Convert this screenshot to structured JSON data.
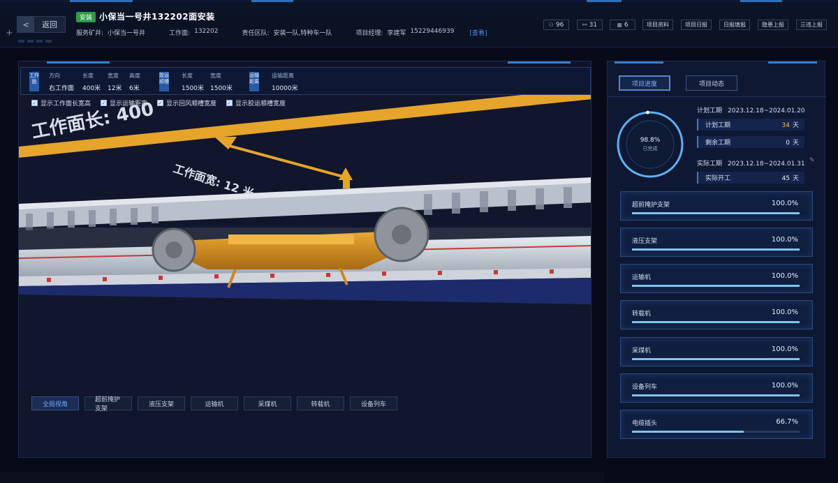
{
  "header": {
    "back_label": "返回",
    "tag": "安装",
    "title": "小保当一号井132202面安装",
    "meta": {
      "mine_label": "服务矿井:",
      "mine_value": "小保当一号井",
      "face_label": "工作面:",
      "face_value": "132202",
      "team_label": "责任区队:",
      "team_value": "安装一队,特种车一队",
      "manager_label": "项目经理:",
      "manager_value": "李建军",
      "phone": "15229446939",
      "view_link": "[查看]"
    },
    "stats": [
      {
        "icon": "people-icon",
        "value": "96"
      },
      {
        "icon": "vehicle-icon",
        "value": "31"
      },
      {
        "icon": "screen-icon",
        "value": "6"
      }
    ],
    "nav": [
      "项目资料",
      "项目日报",
      "日报填报",
      "隐患上报",
      "三违上报"
    ]
  },
  "infobar": {
    "face": {
      "category": "工作面",
      "direction_label": "方向",
      "direction_value": "右工作面",
      "length_label": "长度",
      "length_value": "400米",
      "width_label": "宽度",
      "width_value": "12米",
      "height_label": "高度",
      "height_value": "6米"
    },
    "belt": {
      "category": "胶运顺槽",
      "length_label": "长度",
      "length_value": "1500米",
      "width_label": "宽度",
      "width_value": "1500米"
    },
    "transport": {
      "category": "运输距离",
      "distance_label": "运输距离",
      "distance_value": "10000米"
    }
  },
  "checkboxes": [
    "显示工作面长宽高",
    "显示运输距离",
    "显示回风顺槽宽度",
    "显示胶运顺槽宽度"
  ],
  "scene": {
    "label_face_length": "工作面长: 400",
    "label_face_width": "工作面宽: 12 米"
  },
  "scene_tabs": [
    "全局视角",
    "超前掩护支架",
    "液压支架",
    "运输机",
    "采煤机",
    "转载机",
    "设备列车"
  ],
  "right": {
    "tabs": [
      "项目进度",
      "项目动态"
    ],
    "gauge": {
      "value": 98.8,
      "pct_text": "98.8%",
      "sub": "已完成"
    },
    "planned": {
      "label": "计划工期",
      "range": "2023.12.18~2024.01.20",
      "rows": [
        {
          "label": "计划工期",
          "value": "34",
          "unit": "天"
        },
        {
          "label": "剩余工期",
          "value": "0",
          "unit": "天"
        }
      ]
    },
    "actual": {
      "label": "实际工期",
      "range": "2023.12.18~2024.01.31",
      "rows": [
        {
          "label": "实际开工",
          "value": "45",
          "unit": "天"
        }
      ]
    },
    "progress": [
      {
        "name": "超前掩护支架",
        "pct": "100.0%",
        "value": 100.0
      },
      {
        "name": "液压支架",
        "pct": "100.0%",
        "value": 100.0
      },
      {
        "name": "运输机",
        "pct": "100.0%",
        "value": 100.0
      },
      {
        "name": "转载机",
        "pct": "100.0%",
        "value": 100.0
      },
      {
        "name": "采煤机",
        "pct": "100.0%",
        "value": 100.0
      },
      {
        "name": "设备列车",
        "pct": "100.0%",
        "value": 100.0
      },
      {
        "name": "电缆插头",
        "pct": "66.7%",
        "value": 66.7
      }
    ]
  },
  "colors": {
    "accent": "#3a7ec9",
    "progress_fill": "#7fc4f0",
    "tag_green": "#2e9a48",
    "highlight_yellow": "#f0c24a",
    "machine_orange": "#d99a2a"
  }
}
